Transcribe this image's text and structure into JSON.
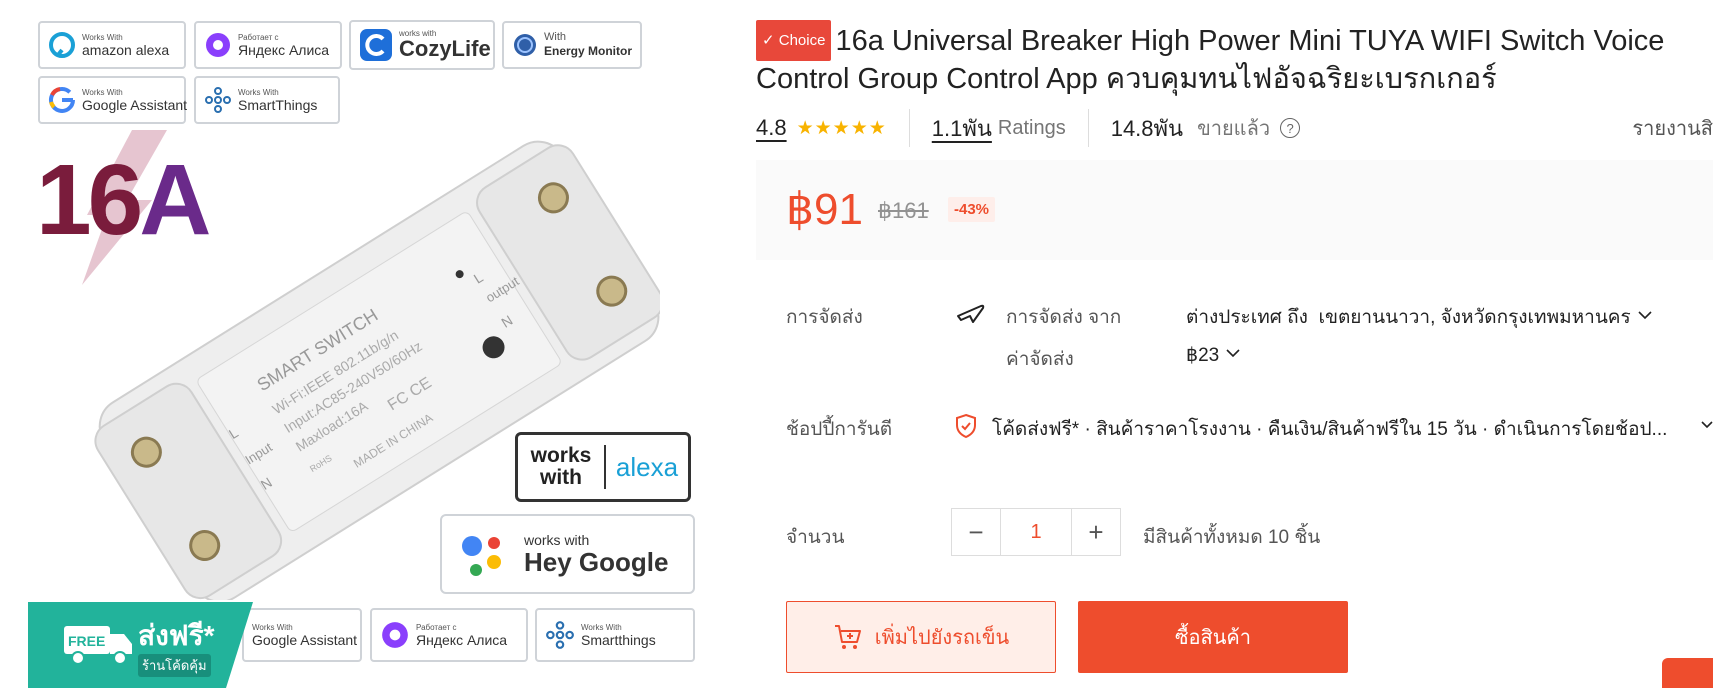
{
  "image": {
    "chips_top": [
      {
        "small": "Works With",
        "big": "amazon alexa",
        "icon": "alexa-ring-icon"
      },
      {
        "small": "Работает с",
        "big": "Яндекс Алиса",
        "icon": "alice-icon"
      },
      {
        "small": "works with",
        "big": "CozyLife",
        "icon": "cozylife-icon"
      },
      {
        "small": "With",
        "big": "Energy Monitor",
        "icon": "energy-globe-icon"
      },
      {
        "small": "Works With",
        "big": "Google Assistant",
        "icon": "google-g-icon"
      },
      {
        "small": "Works With",
        "big": "SmartThings",
        "icon": "smartthings-icon"
      }
    ],
    "big_label_num": "16",
    "big_label_letter": "A",
    "switch_text": {
      "brand": "SMART SWITCH",
      "line1": "Wi-Fi:IEEE 802.11b/g/n",
      "line2": "Input:AC85-240V50/60Hz",
      "line3": "Maxload:16A",
      "made": "MADE IN CHINA",
      "input": "Input",
      "output": "output",
      "l": "L",
      "n": "N",
      "certs": "FC CE",
      "rohs": "RoHS"
    },
    "works_with_alexa": {
      "left": "works with",
      "right": "alexa"
    },
    "hey_google": {
      "small": "works with",
      "big": "Hey Google"
    },
    "chips_bottom": [
      {
        "small": "Works With",
        "big": "Google Assistant"
      },
      {
        "small": "Работает с",
        "big": "Яндекс Алиса"
      },
      {
        "small": "Works With",
        "big": "Smartthings"
      }
    ],
    "free_badge": {
      "title": "ส่งฟรี*",
      "sub": "ร้านโค้ดคุ้ม",
      "truck_text": "FREE"
    }
  },
  "product": {
    "badge": "Choice",
    "title": "16a Universal Breaker High Power Mini TUYA WIFI Switch Voice Control Group Control App ควบคุมทนไฟอัจฉริยะเบรกเกอร์",
    "rating": "4.8",
    "stars": "★★★★★",
    "ratings_count": "1.1พัน",
    "ratings_label": "Ratings",
    "sold_count": "14.8พัน",
    "sold_label": "ขายแล้ว",
    "help_icon": "?",
    "report_label": "รายงานสิ"
  },
  "price": {
    "current": "฿91",
    "original": "฿161",
    "discount": "-43%"
  },
  "shipping": {
    "label": "การจัดส่ง",
    "from_label": "การจัดส่ง จาก",
    "origin": "ต่างประเทศ",
    "to_word": "ถึง",
    "destination": "เขตยานนาวา, จังหวัดกรุงเทพมหานคร",
    "fee_label": "ค่าจัดส่ง",
    "fee": "฿23"
  },
  "guarantee": {
    "label": "ช้อปปี้การันตี",
    "text": "โค้ดส่งฟรี* · สินค้าราคาโรงงาน · คืนเงิน/สินค้าฟรีใน 15 วัน · ดำเนินการโดยช้อป..."
  },
  "quantity": {
    "label": "จำนวน",
    "minus": "−",
    "value": "1",
    "plus": "+",
    "stock": "มีสินค้าทั้งหมด 10 ชิ้น"
  },
  "actions": {
    "add_to_cart": "เพิ่มไปยังรถเข็น",
    "buy_now": "ซื้อสินค้า"
  },
  "colors": {
    "accent": "#ee4d2d",
    "star": "#f8b300",
    "teal": "#22b39b"
  }
}
